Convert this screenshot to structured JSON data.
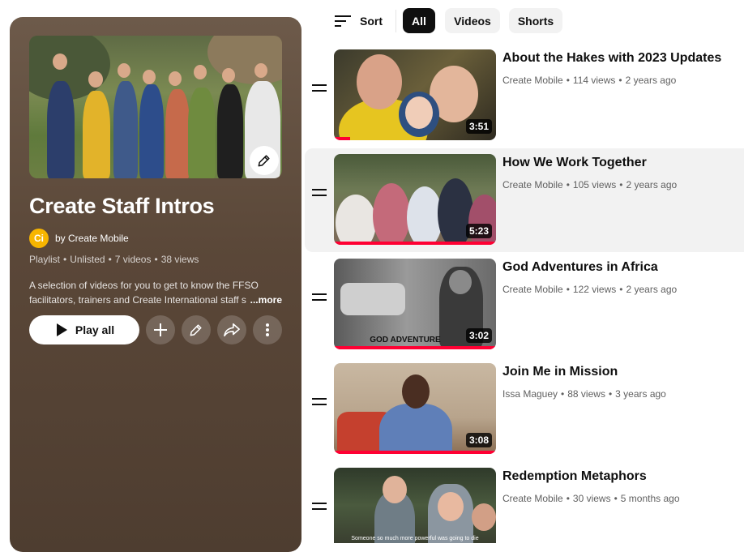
{
  "playlist": {
    "title": "Create Staff Intros",
    "owner": "by Create Mobile",
    "owner_avatar_text": "Ci",
    "type": "Playlist",
    "visibility": "Unlisted",
    "video_count": "7 videos",
    "views": "38 views",
    "description": "A selection of videos for you to get to know the FFSO facilitators, trainers and Create International staff s",
    "more_label": "...more",
    "play_all_label": "Play all"
  },
  "filters": {
    "sort_label": "Sort",
    "chips": [
      "All",
      "Videos",
      "Shorts"
    ],
    "active_chip": "All"
  },
  "videos": [
    {
      "title": "About the Hakes with 2023 Updates",
      "channel": "Create Mobile",
      "views": "114 views",
      "age": "2 years ago",
      "duration": "3:51"
    },
    {
      "title": "How We Work Together",
      "channel": "Create Mobile",
      "views": "105 views",
      "age": "2 years ago",
      "duration": "5:23"
    },
    {
      "title": "God Adventures in Africa",
      "channel": "Create Mobile",
      "views": "122 views",
      "age": "2 years ago",
      "duration": "3:02",
      "thumb_text": "GOD ADVENTURE"
    },
    {
      "title": "Join Me in Mission",
      "channel": "Issa Maguey",
      "views": "88 views",
      "age": "3 years ago",
      "duration": "3:08"
    },
    {
      "title": "Redemption Metaphors",
      "channel": "Create Mobile",
      "views": "30 views",
      "age": "5 months ago",
      "thumb_text": "Someone so much more powerful was going to die"
    }
  ],
  "colors": {
    "panel": "#5a4738",
    "progress": "#ff0033",
    "owner_avatar": "#f7b500",
    "hover_row": "#f2f2f2"
  },
  "icons": {
    "sort": "sort-lines-icon",
    "edit": "pencil-icon",
    "play": "play-triangle-icon",
    "add": "plus-icon",
    "share": "share-arrow-icon",
    "more": "vertical-dots-icon",
    "drag": "drag-handle-icon"
  }
}
